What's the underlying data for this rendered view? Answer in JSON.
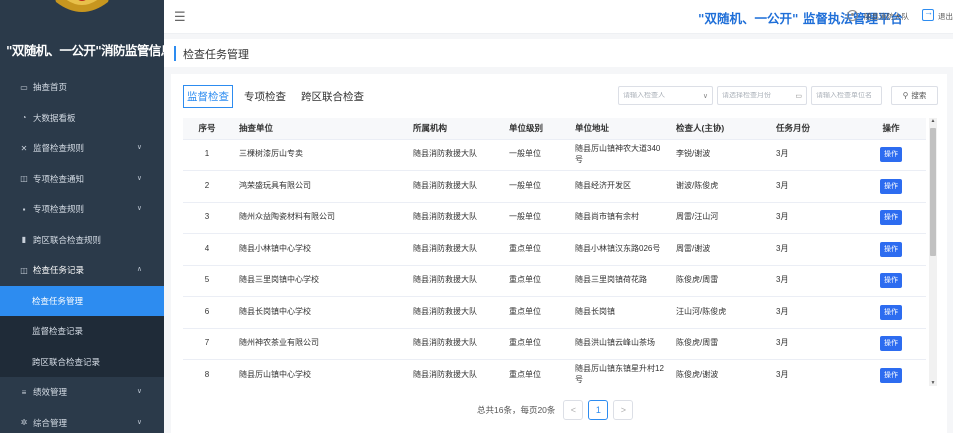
{
  "app": {
    "system_title": "\"双随机、一公开\"消防监管信息系统",
    "platform_title": "\"双随机、一公开\" 监督执法管理平台"
  },
  "user": {
    "name": "随县消防大队",
    "logout": "退出"
  },
  "sidebar": {
    "items": [
      {
        "label": "抽查首页",
        "icon": "monitor-icon"
      },
      {
        "label": "大数据看板",
        "icon": "dashboard-icon"
      },
      {
        "label": "监督检查规则",
        "icon": "tools-icon"
      },
      {
        "label": "专项检查通知",
        "icon": "notice-icon"
      },
      {
        "label": "专项检查规则",
        "icon": "file-icon"
      },
      {
        "label": "跨区联合检查规则",
        "icon": "chart-icon"
      },
      {
        "label": "检查任务记录",
        "icon": "record-icon"
      },
      {
        "label": "检查任务管理"
      },
      {
        "label": "监督检查记录"
      },
      {
        "label": "跨区联合检查记录"
      },
      {
        "label": "绩效管理",
        "icon": "list-icon"
      },
      {
        "label": "综合管理",
        "icon": "gear-icon"
      }
    ]
  },
  "page": {
    "title": "检查任务管理"
  },
  "tabs": [
    {
      "label": "监督检查"
    },
    {
      "label": "专项检查"
    },
    {
      "label": "跨区联合检查"
    }
  ],
  "filters": {
    "inspector_placeholder": "请输入检查人",
    "month_placeholder": "请选择检查月份",
    "unit_placeholder": "请输入检查单位名",
    "search_label": "搜索"
  },
  "table": {
    "headers": [
      "序号",
      "抽查单位",
      "所属机构",
      "单位级别",
      "单位地址",
      "检查人(主协)",
      "任务月份",
      "操作"
    ],
    "rows": [
      {
        "no": "1",
        "unit": "三棵树漆厉山专卖",
        "org": "随县消防救援大队",
        "level": "一般单位",
        "address": "随县厉山镇神农大道340号",
        "inspector": "李锐/谢波",
        "month": "3月",
        "op": "操作"
      },
      {
        "no": "2",
        "unit": "鸿荣盛玩具有限公司",
        "org": "随县消防救援大队",
        "level": "一般单位",
        "address": "随县经济开发区",
        "inspector": "谢波/陈俊虎",
        "month": "3月",
        "op": "操作"
      },
      {
        "no": "3",
        "unit": "随州众益陶瓷材料有限公司",
        "org": "随县消防救援大队",
        "level": "一般单位",
        "address": "随县尚市镇有余村",
        "inspector": "周雷/汪山河",
        "month": "3月",
        "op": "操作"
      },
      {
        "no": "4",
        "unit": "随县小林镇中心学校",
        "org": "随县消防救援大队",
        "level": "重点单位",
        "address": "随县小林镇汉东路026号",
        "inspector": "周雷/谢波",
        "month": "3月",
        "op": "操作"
      },
      {
        "no": "5",
        "unit": "随县三里岗镇中心学校",
        "org": "随县消防救援大队",
        "level": "重点单位",
        "address": "随县三里岗镇荷花路",
        "inspector": "陈俊虎/周雷",
        "month": "3月",
        "op": "操作"
      },
      {
        "no": "6",
        "unit": "随县长岗镇中心学校",
        "org": "随县消防救援大队",
        "level": "重点单位",
        "address": "随县长岗镇",
        "inspector": "汪山河/陈俊虎",
        "month": "3月",
        "op": "操作"
      },
      {
        "no": "7",
        "unit": "随州神农茶业有限公司",
        "org": "随县消防救援大队",
        "level": "重点单位",
        "address": "随县洪山镇云峰山茶场",
        "inspector": "陈俊虎/周雷",
        "month": "3月",
        "op": "操作"
      },
      {
        "no": "8",
        "unit": "随县厉山镇中心学校",
        "org": "随县消防救援大队",
        "level": "重点单位",
        "address": "随县厉山镇东镇星升村12号",
        "inspector": "陈俊虎/谢波",
        "month": "3月",
        "op": "操作"
      }
    ]
  },
  "pagination": {
    "summary": "总共16条，每页20条",
    "prev": "<",
    "current": "1",
    "next": ">"
  },
  "colors": {
    "accent": "#2d8cf0",
    "sidebar_bg": "#2b3a4a",
    "platform_title": "#1f6fd8"
  }
}
